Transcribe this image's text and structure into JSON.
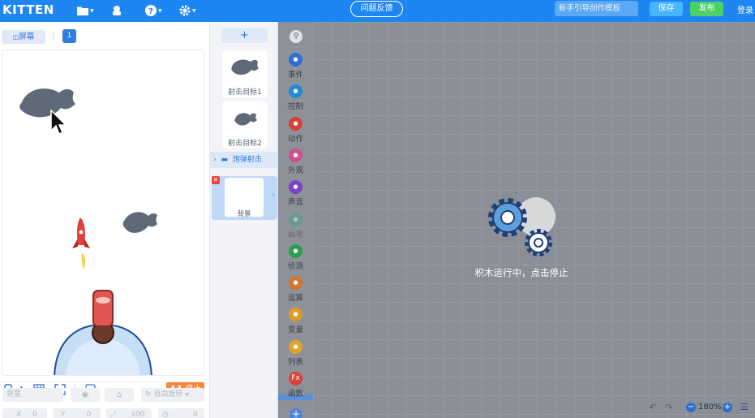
{
  "app": {
    "logo": "KITTEN"
  },
  "topbar": {
    "feedback_label": "问题反馈",
    "template_placeholder": "新手引导创作模板",
    "save_label": "保存",
    "publish_label": "发布",
    "login_label": "登录",
    "icons": [
      "folder-icon",
      "profile-icon",
      "help-icon",
      "settings-icon"
    ]
  },
  "stage": {
    "screen_label": "屏幕",
    "screen_number": "1",
    "stop_label": "停止",
    "properties": {
      "name_placeholder": "背景",
      "rotation_label": "自由旋转",
      "x_label": "X",
      "x_value": "0",
      "y_label": "Y",
      "y_value": "0",
      "size_value": "100",
      "angle_value": "0"
    }
  },
  "sprites": {
    "add_label": "+",
    "items": [
      {
        "name": "射击目标1"
      },
      {
        "name": "射击目标2"
      }
    ],
    "folder_label": "炮弹射击",
    "background_label": "背景"
  },
  "categories": [
    {
      "label": "事件",
      "color": "#2e6fd6",
      "icon": "event-icon"
    },
    {
      "label": "控制",
      "color": "#2689d9",
      "icon": "control-icon"
    },
    {
      "label": "动作",
      "color": "#d8413a",
      "icon": "motion-icon"
    },
    {
      "label": "外观",
      "color": "#cf4f8f",
      "icon": "appearance-icon"
    },
    {
      "label": "声音",
      "color": "#7b43c8",
      "icon": "sound-icon"
    },
    {
      "label": "画笔",
      "color": "#3aa58a",
      "icon": "pen-icon",
      "faded": true
    },
    {
      "label": "侦测",
      "color": "#2f9d4e",
      "icon": "sensing-icon"
    },
    {
      "label": "运算",
      "color": "#d3752e",
      "icon": "operator-icon"
    },
    {
      "label": "变量",
      "color": "#e09a28",
      "icon": "variable-icon"
    },
    {
      "label": "列表",
      "color": "#e0a42a",
      "icon": "list-icon"
    },
    {
      "label": "函数",
      "color": "#d9423a",
      "icon": "function-icon",
      "symbol": "Fx"
    }
  ],
  "workspace": {
    "running_text": "积木运行中，点击停止",
    "zoom_label": "180%"
  }
}
